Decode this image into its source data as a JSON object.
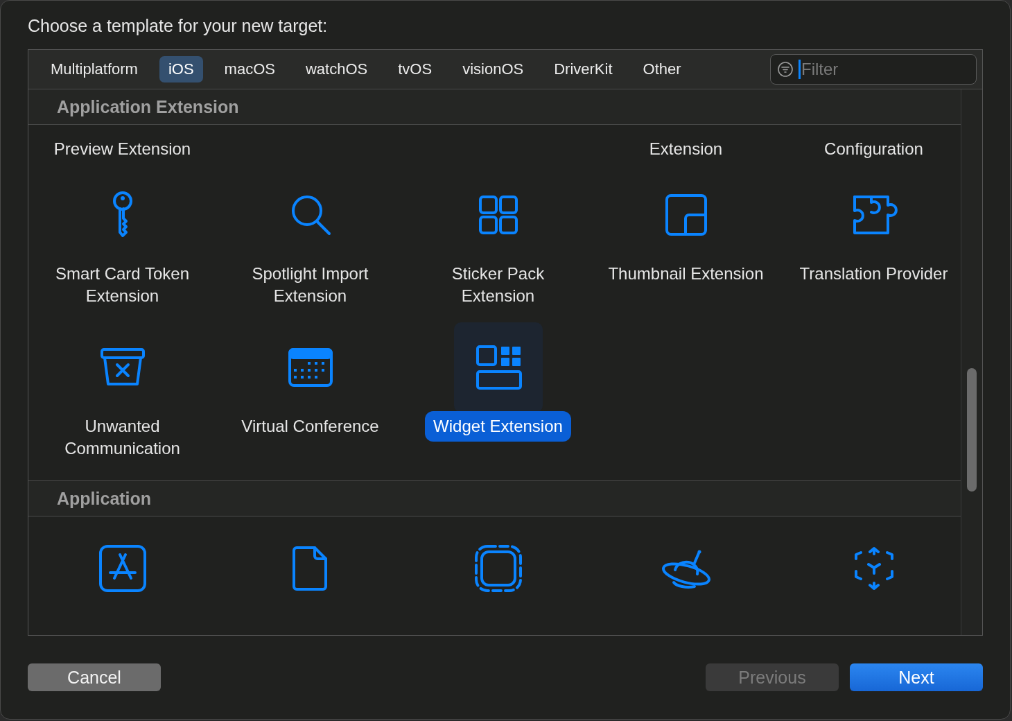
{
  "dialog": {
    "title": "Choose a template for your new target:"
  },
  "tabs": [
    {
      "label": "Multiplatform",
      "selected": false
    },
    {
      "label": "iOS",
      "selected": true
    },
    {
      "label": "macOS",
      "selected": false
    },
    {
      "label": "watchOS",
      "selected": false
    },
    {
      "label": "tvOS",
      "selected": false
    },
    {
      "label": "visionOS",
      "selected": false
    },
    {
      "label": "DriverKit",
      "selected": false
    },
    {
      "label": "Other",
      "selected": false
    }
  ],
  "filter": {
    "placeholder": "Filter"
  },
  "sections": [
    {
      "title": "Application Extension",
      "partial_row": [
        "Preview Extension",
        "Extension",
        "Configuration"
      ],
      "items": [
        {
          "label": "Smart Card Token Extension",
          "selected": false
        },
        {
          "label": "Spotlight Import Extension",
          "selected": false
        },
        {
          "label": "Sticker Pack Extension",
          "selected": false
        },
        {
          "label": "Thumbnail Extension",
          "selected": false
        },
        {
          "label": "Translation Provider",
          "selected": false
        },
        {
          "label": "Unwanted Communication",
          "selected": false
        },
        {
          "label": "Virtual Conference",
          "selected": false
        },
        {
          "label": "Widget Extension",
          "selected": true
        }
      ]
    },
    {
      "title": "Application",
      "items": [
        {
          "selected": false
        },
        {
          "selected": false
        },
        {
          "selected": false
        },
        {
          "selected": false
        },
        {
          "selected": false
        }
      ]
    }
  ],
  "buttons": [
    {
      "label": "Cancel",
      "kind": "cancel"
    },
    {
      "label": "Previous",
      "kind": "secondary",
      "disabled": true
    },
    {
      "label": "Next",
      "kind": "primary",
      "disabled": false
    }
  ]
}
